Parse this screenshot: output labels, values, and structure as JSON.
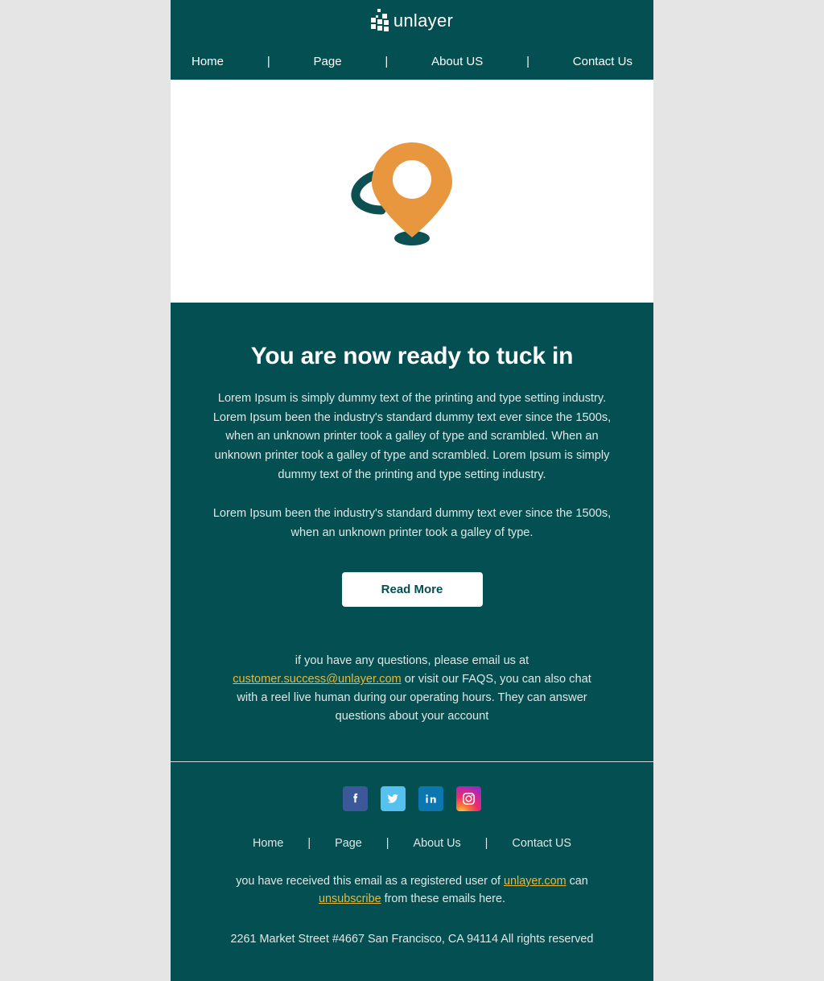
{
  "theme": {
    "page_background": "#e5e5e5",
    "brand_teal": "#034f51",
    "accent_orange": "#e8973f",
    "link_gold": "#e8b83a",
    "text_light": "#dfe7e6",
    "white": "#ffffff"
  },
  "header": {
    "logo_text": "unlayer",
    "logo_icon": "unlayer-mosaic-logo"
  },
  "topnav": {
    "separator": "|",
    "items": [
      {
        "label": "Home"
      },
      {
        "label": "Page"
      },
      {
        "label": "About US"
      },
      {
        "label": "Contact Us"
      }
    ]
  },
  "hero": {
    "image_alt": "map-location-pin-illustration",
    "pin_color": "#e8973f",
    "shadow_color": "#0d5054",
    "arrow_color": "#0d5054"
  },
  "content": {
    "headline": "You are now ready to tuck in",
    "paragraph_1": "Lorem Ipsum is simply dummy text of the printing and type setting industry. Lorem Ipsum been the industry's standard dummy text ever since the 1500s, when an unknown printer took a galley of type and scrambled. When an unknown printer took a galley of type and scrambled. Lorem Ipsum is simply dummy text of the printing and type setting industry.",
    "paragraph_2": "Lorem Ipsum been the industry's standard dummy text ever since the 1500s, when an unknown printer took a galley of type.",
    "read_more_label": "Read More",
    "contact": {
      "before_link": "if you have any questions, please email us at ",
      "email_link": "customer.success@unlayer.com",
      "after_link": " or visit our FAQS, you can also chat with a reel live human during our operating hours. They can answer questions about your account"
    }
  },
  "footer": {
    "social": [
      {
        "name": "facebook",
        "label": "Facebook"
      },
      {
        "name": "twitter",
        "label": "Twitter"
      },
      {
        "name": "linkedin",
        "label": "LinkedIn"
      },
      {
        "name": "instagram",
        "label": "Instagram"
      }
    ],
    "separator": "|",
    "nav": [
      {
        "label": "Home"
      },
      {
        "label": "Page"
      },
      {
        "label": "About Us"
      },
      {
        "label": "Contact US"
      }
    ],
    "registered_before": "you have received this email as a registered user of ",
    "registered_link": "unlayer.com",
    "registered_mid": " can ",
    "unsubscribe_link": "unsubscribe",
    "registered_after": " from these emails here.",
    "address": "2261 Market Street #4667 San Francisco, CA 94114 All rights reserved"
  }
}
